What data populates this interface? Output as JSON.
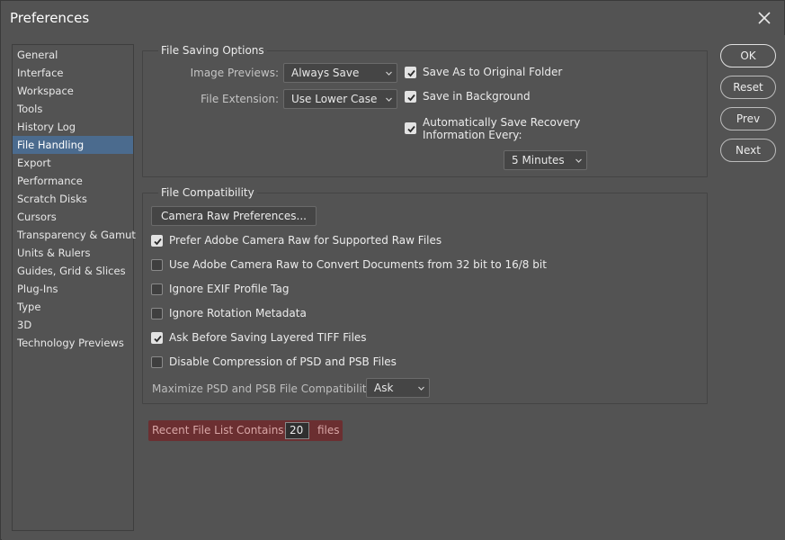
{
  "window": {
    "title": "Preferences"
  },
  "sidebar": {
    "items": [
      {
        "label": "General"
      },
      {
        "label": "Interface"
      },
      {
        "label": "Workspace"
      },
      {
        "label": "Tools"
      },
      {
        "label": "History Log"
      },
      {
        "label": "File Handling",
        "selected": true
      },
      {
        "label": "Export"
      },
      {
        "label": "Performance"
      },
      {
        "label": "Scratch Disks"
      },
      {
        "label": "Cursors"
      },
      {
        "label": "Transparency & Gamut"
      },
      {
        "label": "Units & Rulers"
      },
      {
        "label": "Guides, Grid & Slices"
      },
      {
        "label": "Plug-Ins"
      },
      {
        "label": "Type"
      },
      {
        "label": "3D"
      },
      {
        "label": "Technology Previews"
      }
    ]
  },
  "file_saving": {
    "title": "File Saving Options",
    "image_previews_label": "Image Previews:",
    "image_previews_value": "Always Save",
    "file_extension_label": "File Extension:",
    "file_extension_value": "Use Lower Case",
    "save_as_original": {
      "label": "Save As to Original Folder",
      "checked": true
    },
    "save_in_background": {
      "label": "Save in Background",
      "checked": true
    },
    "auto_save_line1": "Automatically Save Recovery",
    "auto_save_line2": "Information Every:",
    "auto_save_checked": true,
    "auto_save_interval": "5 Minutes"
  },
  "file_compat": {
    "title": "File Compatibility",
    "camera_raw_button": "Camera Raw Preferences...",
    "options": [
      {
        "label": "Prefer Adobe Camera Raw for Supported Raw Files",
        "checked": true
      },
      {
        "label": "Use Adobe Camera Raw to Convert Documents from 32 bit to 16/8 bit",
        "checked": false
      },
      {
        "label": "Ignore EXIF Profile Tag",
        "checked": false
      },
      {
        "label": "Ignore Rotation Metadata",
        "checked": false
      },
      {
        "label": "Ask Before Saving Layered TIFF Files",
        "checked": true
      },
      {
        "label": "Disable Compression of PSD and PSB Files",
        "checked": false
      }
    ],
    "maximize_label": "Maximize PSD and PSB File Compatibility:",
    "maximize_value": "Ask"
  },
  "recent_files": {
    "label": "Recent File List Contains:",
    "value": "20",
    "suffix": "files"
  },
  "buttons": {
    "ok": "OK",
    "reset": "Reset",
    "prev": "Prev",
    "next": "Next"
  },
  "icons": {
    "close": "close-icon",
    "chevron": "chevron-down-icon",
    "check": "check-icon"
  },
  "colors": {
    "selection": "#4b6b8e",
    "highlight": "#6b2f31"
  }
}
